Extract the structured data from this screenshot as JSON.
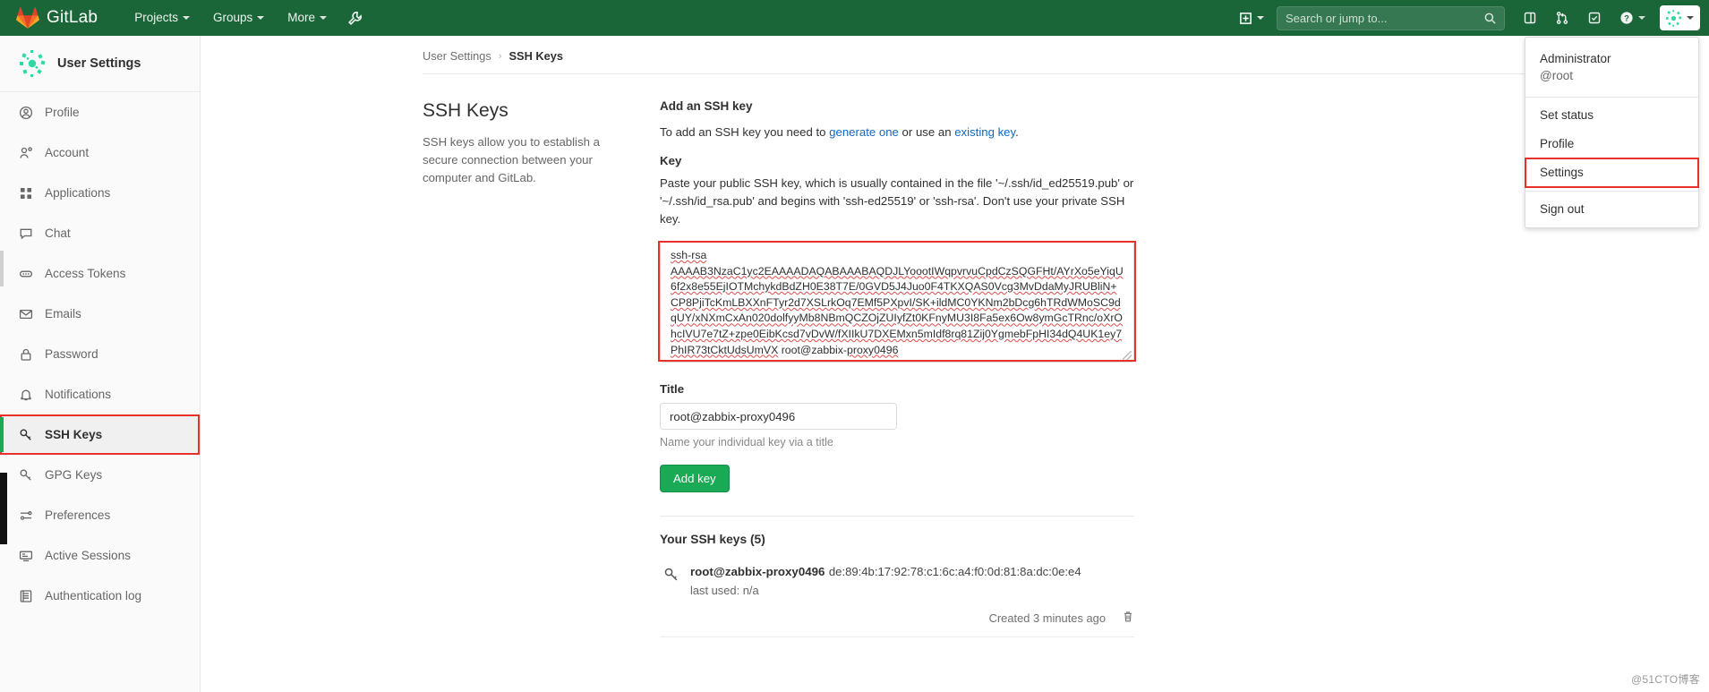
{
  "navbar": {
    "brand": "GitLab",
    "logo_icon": "gitlab-tanuki-logo",
    "links": [
      {
        "label": "Projects",
        "icon": "chevron-down-icon"
      },
      {
        "label": "Groups",
        "icon": "chevron-down-icon"
      },
      {
        "label": "More",
        "icon": "chevron-down-icon"
      }
    ],
    "wrench_icon": "wrench-icon",
    "plus_icon": "plus-square-icon",
    "search": {
      "placeholder": "Search or jump to...",
      "value": "",
      "icon": "search-icon"
    },
    "tools": [
      {
        "icon": "issues-board-icon",
        "name": "issue-boards-icon"
      },
      {
        "icon": "merge-request-icon",
        "name": "merge-requests-icon"
      },
      {
        "icon": "todos-icon",
        "name": "todos-icon"
      },
      {
        "icon": "help-icon",
        "name": "help-icon"
      }
    ],
    "avatar_icon": "user-avatar-icon"
  },
  "user_dropdown": {
    "name": "Administrator",
    "handle": "@root",
    "items": [
      {
        "label": "Set status",
        "highlighted": false
      },
      {
        "label": "Profile",
        "highlighted": false
      },
      {
        "label": "Settings",
        "highlighted": true
      },
      {
        "label": "Sign out",
        "highlighted": false
      }
    ],
    "highlight_color": "#e8312a"
  },
  "sidebar": {
    "context_title": "User Settings",
    "context_icon": "user-settings-avatar",
    "items": [
      {
        "label": "Profile",
        "icon": "user-circle-icon",
        "active": false,
        "highlighted": false
      },
      {
        "label": "Account",
        "icon": "account-gear-icon",
        "active": false,
        "highlighted": false
      },
      {
        "label": "Applications",
        "icon": "applications-grid-icon",
        "active": false,
        "highlighted": false
      },
      {
        "label": "Chat",
        "icon": "chat-bubble-icon",
        "active": false,
        "highlighted": false
      },
      {
        "label": "Access Tokens",
        "icon": "token-icon",
        "active": false,
        "highlighted": false
      },
      {
        "label": "Emails",
        "icon": "envelope-icon",
        "active": false,
        "highlighted": false
      },
      {
        "label": "Password",
        "icon": "lock-icon",
        "active": false,
        "highlighted": false
      },
      {
        "label": "Notifications",
        "icon": "bell-icon",
        "active": false,
        "highlighted": false
      },
      {
        "label": "SSH Keys",
        "icon": "key-icon",
        "active": true,
        "highlighted": true
      },
      {
        "label": "GPG Keys",
        "icon": "key-icon",
        "active": false,
        "highlighted": false
      },
      {
        "label": "Preferences",
        "icon": "sliders-icon",
        "active": false,
        "highlighted": false
      },
      {
        "label": "Active Sessions",
        "icon": "monitor-icon",
        "active": false,
        "highlighted": false
      },
      {
        "label": "Authentication log",
        "icon": "log-list-icon",
        "active": false,
        "highlighted": false
      }
    ],
    "active_accent": "#1aaa55",
    "highlight_color": "#e8312a"
  },
  "breadcrumb": {
    "root": "User Settings",
    "separator": "›",
    "current": "SSH Keys"
  },
  "page": {
    "heading": "SSH Keys",
    "description": "SSH keys allow you to establish a secure connection between your computer and GitLab."
  },
  "form": {
    "section_title": "Add an SSH key",
    "intro_prefix": "To add an SSH key you need to ",
    "intro_link1": "generate one",
    "intro_middle": " or use an ",
    "intro_link2": "existing key",
    "intro_suffix": ".",
    "key_label": "Key",
    "key_help_line1": "Paste your public SSH key, which is usually contained in the file '~/.ssh/id_ed25519.pub' or",
    "key_help_line2": "'~/.ssh/id_rsa.pub' and begins with 'ssh-ed25519' or 'ssh-rsa'. Don't use your private SSH key.",
    "key_value_head": "ssh-rsa",
    "key_value_body": "AAAAB3NzaC1yc2EAAAADAQABAAABAQDJLYoootIWqpvrvuCpdCzSQGFHt/AYrXo5eYiqU6f2x8e55EjIOTMchykdBdZH0E38T7E/0GVD5J4Juo0F4TKXQAS0Vcg3MvDdaMyJRUBliN+CP8PjiTcKmLBXXnFTyr2d7XSLrkOq7EMf5PXpvI/SK+ildMC0YKNm2bDcg6hTRdWMoSC9dqUY/xNXmCxAn020dolfyyMb8NBmQCZOjZUIyfZt0KFnyMU3I8Fa5ex6Ow8ymGcTRnc/oXrOhcIVU7e7tZ+zpe0EibKcsd7vDvW/fXIIkU7DXEMxn5mIdf8rq81Zij0YgmebFpHI34dQ4UK1ey7PhIR73tCktUdsUmVX",
    "key_value_tail_user": " root@zabbix-",
    "key_value_tail_host": "proxy0496",
    "title_label": "Title",
    "title_value": "root@zabbix-proxy0496",
    "title_help": "Name your individual key via a title",
    "submit_label": "Add key",
    "annotation_color": "#e8312a"
  },
  "keys_list": {
    "heading": "Your SSH keys (5)",
    "rows": [
      {
        "icon": "key-icon",
        "name": "root@zabbix-proxy0496",
        "fingerprint": "de:89:4b:17:92:78:c1:6c:a4:f0:0d:81:8a:dc:0e:e4",
        "last_used_label": "last used: n/a",
        "created": "Created 3 minutes ago",
        "delete_icon": "trash-icon"
      }
    ]
  },
  "watermark": "@51CTO博客"
}
